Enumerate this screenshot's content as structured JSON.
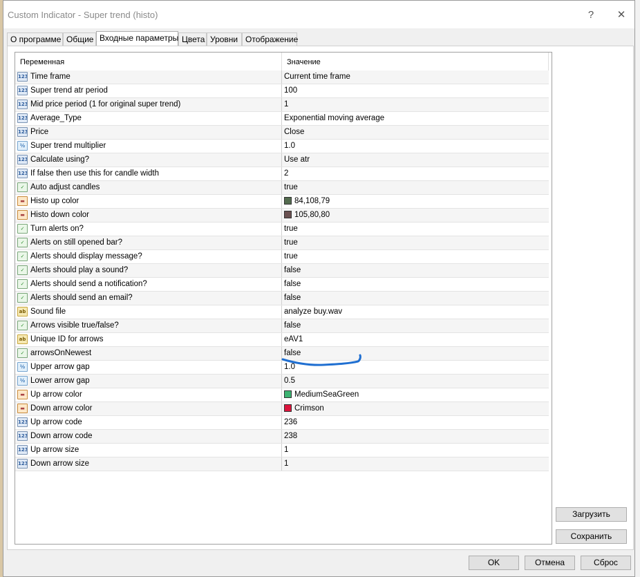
{
  "window": {
    "title": "Custom Indicator - Super trend (histo)",
    "help_glyph": "?",
    "close_glyph": "✕"
  },
  "tabs": [
    {
      "label": "О программе"
    },
    {
      "label": "Общие"
    },
    {
      "label": "Входные параметры",
      "active": true
    },
    {
      "label": "Цвета"
    },
    {
      "label": "Уровни"
    },
    {
      "label": "Отображение"
    }
  ],
  "grid": {
    "headers": {
      "variable": "Переменная",
      "value": "Значение"
    },
    "rows": [
      {
        "icon": "int-icon",
        "badge": "123",
        "name": "Time frame",
        "value": "Current time frame"
      },
      {
        "icon": "int-icon",
        "badge": "123",
        "name": "Super trend atr period",
        "value": "100"
      },
      {
        "icon": "int-icon",
        "badge": "123",
        "name": "Mid price period (1 for original super trend)",
        "value": "1"
      },
      {
        "icon": "int-icon",
        "badge": "123",
        "name": "Average_Type",
        "value": "Exponential moving average"
      },
      {
        "icon": "int-icon",
        "badge": "123",
        "name": "Price",
        "value": "Close"
      },
      {
        "icon": "double-icon",
        "badge": "½",
        "name": "Super trend multiplier",
        "value": "1.0"
      },
      {
        "icon": "int-icon",
        "badge": "123",
        "name": "Calculate using?",
        "value": "Use atr"
      },
      {
        "icon": "int-icon",
        "badge": "123",
        "name": "If  false then use this for candle width",
        "value": "2"
      },
      {
        "icon": "bool-icon",
        "badge": "✓",
        "name": "Auto adjust candles",
        "value": "true"
      },
      {
        "icon": "color-icon",
        "badge": "▬",
        "name": "Histo up color",
        "value": "84,108,79",
        "swatch": "#546c4f"
      },
      {
        "icon": "color-icon",
        "badge": "▬",
        "name": "Histo down color",
        "value": "105,80,80",
        "swatch": "#695050"
      },
      {
        "icon": "bool-icon",
        "badge": "✓",
        "name": "Turn alerts on?",
        "value": "true"
      },
      {
        "icon": "bool-icon",
        "badge": "✓",
        "name": "Alerts on still opened bar?",
        "value": "true"
      },
      {
        "icon": "bool-icon",
        "badge": "✓",
        "name": "Alerts should display message?",
        "value": "true"
      },
      {
        "icon": "bool-icon",
        "badge": "✓",
        "name": "Alerts should play a sound?",
        "value": "false"
      },
      {
        "icon": "bool-icon",
        "badge": "✓",
        "name": "Alerts should send a notification?",
        "value": "false"
      },
      {
        "icon": "bool-icon",
        "badge": "✓",
        "name": "Alerts should send an email?",
        "value": "false"
      },
      {
        "icon": "string-icon",
        "badge": "ab",
        "name": "Sound file",
        "value": "analyze buy.wav"
      },
      {
        "icon": "bool-icon",
        "badge": "✓",
        "name": "Arrows visible true/false?",
        "value": "false"
      },
      {
        "icon": "string-icon",
        "badge": "ab",
        "name": "Unique ID for arrows",
        "value": "eAV1"
      },
      {
        "icon": "bool-icon",
        "badge": "✓",
        "name": "arrowsOnNewest",
        "value": "false"
      },
      {
        "icon": "double-icon",
        "badge": "½",
        "name": "Upper arrow gap",
        "value": "1.0"
      },
      {
        "icon": "double-icon",
        "badge": "½",
        "name": "Lower arrow gap",
        "value": "0.5"
      },
      {
        "icon": "color-icon",
        "badge": "▬",
        "name": "Up arrow color",
        "value": "MediumSeaGreen",
        "swatch": "#3cb371"
      },
      {
        "icon": "color-icon",
        "badge": "▬",
        "name": "Down arrow color",
        "value": "Crimson",
        "swatch": "#dc143c"
      },
      {
        "icon": "int-icon",
        "badge": "123",
        "name": "Up arrow code",
        "value": "236"
      },
      {
        "icon": "int-icon",
        "badge": "123",
        "name": "Down arrow code",
        "value": "238"
      },
      {
        "icon": "int-icon",
        "badge": "123",
        "name": "Up arrow size",
        "value": "1"
      },
      {
        "icon": "int-icon",
        "badge": "123",
        "name": "Down arrow size",
        "value": "1"
      }
    ]
  },
  "buttons": {
    "load": "Загрузить",
    "save": "Сохранить",
    "ok": "OK",
    "cancel": "Отмена",
    "reset": "Сброс"
  },
  "colors": {
    "annotation_stroke": "#1f6fd1"
  }
}
